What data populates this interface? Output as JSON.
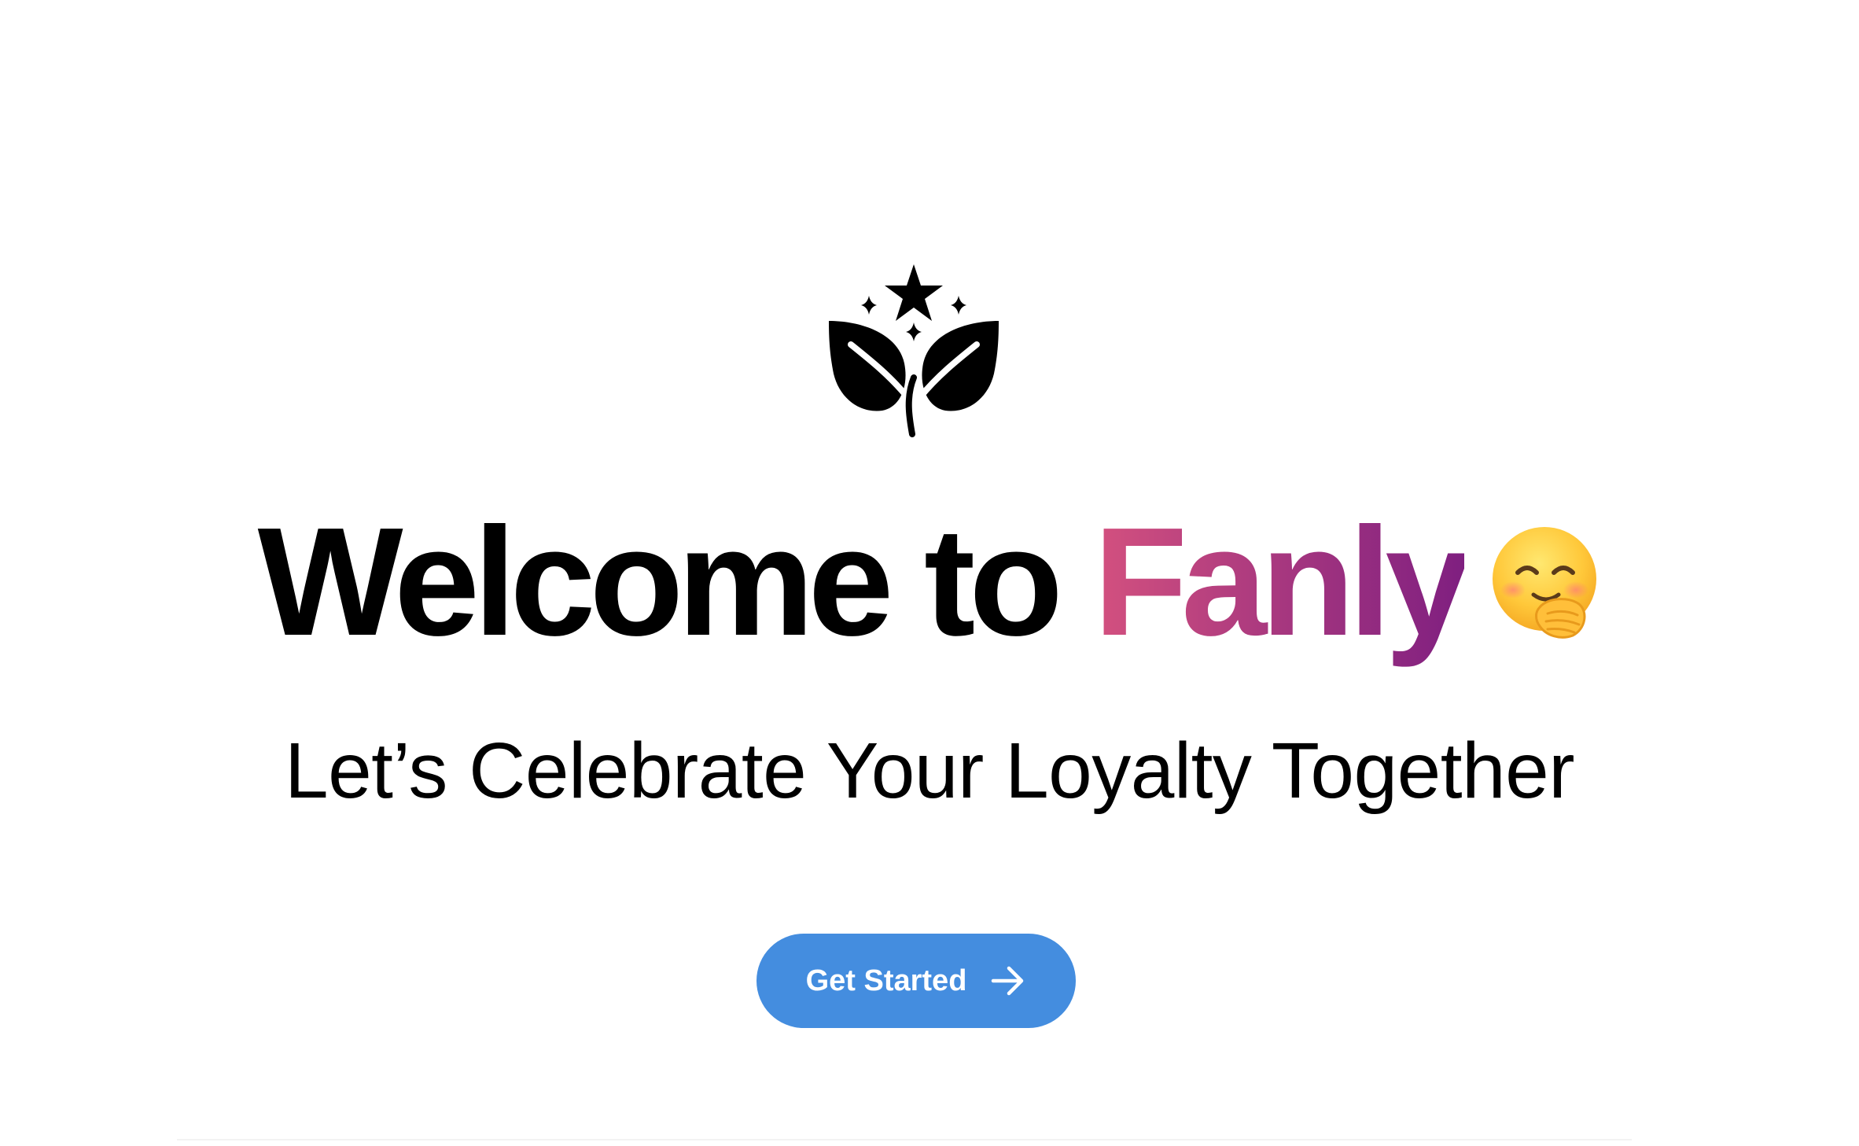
{
  "logo": {
    "icon": "leaves-star-icon",
    "color": "#000000"
  },
  "headline": {
    "prefix": "Welcome to ",
    "brand": "Fanly",
    "brand_gradient": [
      "#d4517f",
      "#a3357f",
      "#7f1f80"
    ],
    "emoji_icon": "smiling-face-hand-over-mouth-icon"
  },
  "subtitle": "Let’s Celebrate Your Loyalty Together",
  "cta": {
    "label": "Get Started",
    "icon": "arrow-right-icon",
    "background": "#448ddf",
    "text_color": "#ffffff"
  }
}
